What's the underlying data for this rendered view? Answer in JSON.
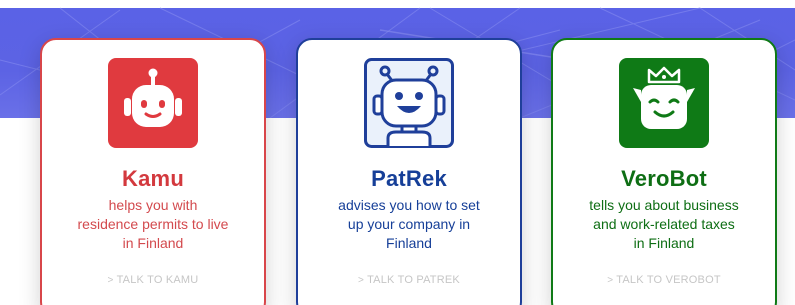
{
  "cards": [
    {
      "name": "Kamu",
      "description_lines": [
        "helps you with",
        "residence permits to live",
        "in Finland"
      ],
      "link_label": "TALK TO KAMU",
      "accent": "#d8464a",
      "icon": "kamu-robot-icon"
    },
    {
      "name": "PatRek",
      "description_lines": [
        "advises you how to set",
        "up your company in",
        "Finland"
      ],
      "link_label": "TALK TO PATREK",
      "accent": "#1f3f9a",
      "icon": "patrek-robot-icon"
    },
    {
      "name": "VeroBot",
      "description_lines": [
        "tells you about business",
        "and work-related taxes",
        "in Finland"
      ],
      "link_label": "TALK TO VEROBOT",
      "accent": "#0f7a16",
      "icon": "verobot-robot-icon"
    }
  ],
  "colors": {
    "hero_background": "#5a62e6",
    "link_gray": "#c6c6c6"
  },
  "icons": {
    "link_chevron": "chevron-right-icon"
  }
}
